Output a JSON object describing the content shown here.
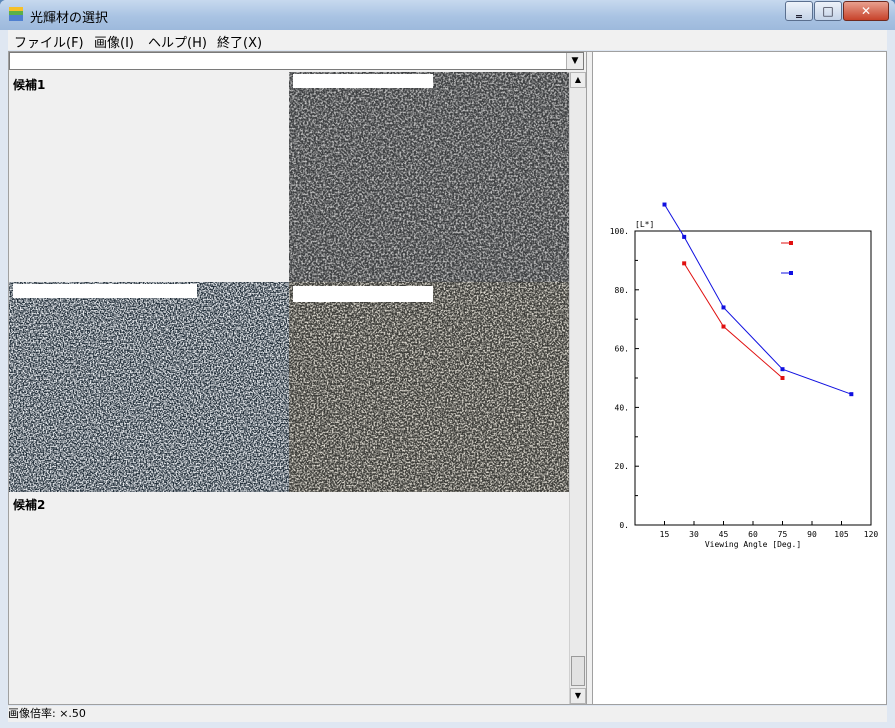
{
  "window": {
    "title": "光輝材の選択"
  },
  "menu": {
    "items": [
      "ファイル(F)",
      "画像(I)",
      "ヘルプ(H)",
      "終了(X)"
    ]
  },
  "combo": {
    "value": ""
  },
  "candidates": {
    "label1": "候補1",
    "label2": "候補2"
  },
  "status": {
    "text": "画像倍率: ×.50"
  },
  "colors": {
    "series1": "#e01010",
    "series2": "#1010e0"
  },
  "chart_data": {
    "type": "line",
    "ylabel": "[L*]",
    "xlabel": "Viewing Angle [Deg.]",
    "xlim": [
      0,
      120
    ],
    "ylim": [
      0,
      100
    ],
    "xticks": [
      15,
      30,
      45,
      60,
      75,
      90,
      105,
      120
    ],
    "yticks": [
      0,
      20,
      40,
      60,
      80,
      100
    ],
    "ytick_labels": [
      "0.",
      "20.",
      "40.",
      "60.",
      "80.",
      "100."
    ],
    "series": [
      {
        "color": "#e01010",
        "x": [
          25,
          45,
          75
        ],
        "y": [
          89,
          67.5,
          50
        ]
      },
      {
        "color": "#1010e0",
        "x": [
          15,
          25,
          45,
          75,
          110
        ],
        "y": [
          109,
          98,
          74,
          53,
          44.5
        ]
      }
    ],
    "legend": "top-right"
  }
}
